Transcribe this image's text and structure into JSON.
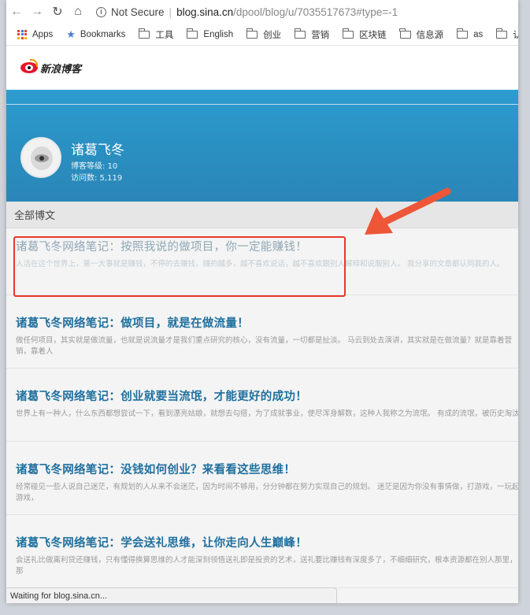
{
  "browser": {
    "not_secure": "Not Secure",
    "url_host": "blog.sina.cn",
    "url_path": "/dpool/blog/u/7035517673#type=-1"
  },
  "bookmarks": [
    {
      "label": "Apps",
      "icon": "apps-icon"
    },
    {
      "label": "Bookmarks",
      "icon": "star-icon"
    },
    {
      "label": "工具",
      "icon": "folder-icon"
    },
    {
      "label": "English",
      "icon": "folder-icon"
    },
    {
      "label": "创业",
      "icon": "folder-icon"
    },
    {
      "label": "营销",
      "icon": "folder-icon"
    },
    {
      "label": "区块链",
      "icon": "folder-icon"
    },
    {
      "label": "信息源",
      "icon": "folder-icon"
    },
    {
      "label": "as",
      "icon": "folder-icon"
    },
    {
      "label": "认",
      "icon": "folder-icon"
    }
  ],
  "site": {
    "logo_text": "新浪博客"
  },
  "profile": {
    "name": "诸葛飞冬",
    "level": "博客等级: 10",
    "visits": "访问数: 5,119"
  },
  "section": {
    "title": "全部博文"
  },
  "posts": [
    {
      "title": "诸葛飞冬网络笔记：按照我说的做项目，你一定能赚钱！",
      "excerpt": "人活在这个世界上，第一大事就是赚钱，不停的去赚钱，赚的越多，越不喜欢说话，越不喜欢跟别人解释和说服别人。 我分享的文章都认同我的人。"
    },
    {
      "title": "诸葛飞冬网络笔记：做项目，就是在做流量！",
      "excerpt": "做任何项目，其实就是做流量，也就是说流量才是我们重点研究的核心，没有流量，一切都是扯淡。 马云到处去演讲，其实就是在做流量？就是靠着营销，靠着人"
    },
    {
      "title": "诸葛飞冬网络笔记：创业就要当流氓，才能更好的成功！",
      "excerpt": "世界上有一种人，什么东西都想尝试一下，看到漂亮姑娘，就想去勾搭，为了成就事业，使尽浑身解数，这种人我称之为流氓。 有成的流氓，被历史淘汰"
    },
    {
      "title": "诸葛飞冬网络笔记：没钱如何创业？来看看这些思维！",
      "excerpt": "经常碰见一些人说自己迷茫，有规划的人从来不会迷茫，因为时间不够用，分分钟都在努力实现自己的规划。 迷茫是因为你没有事情做，打游戏，一玩起游戏，"
    },
    {
      "title": "诸葛飞冬网络笔记：学会送礼思维，让你走向人生巅峰！",
      "excerpt": "会送礼比做离利贷还赚钱，只有懂得换算思维的人才能深刻领悟送礼即是投资的艺术，送礼要比赚钱有深度多了，不细细研究，根本资源都在别人那里，那"
    }
  ],
  "status_bar": "Waiting for blog.sina.cn...",
  "colors": {
    "banner": "#2a8fc1",
    "title_link": "#1f6f9e",
    "annotation_red": "#e8382a",
    "annotation_arrow": "#ee5638"
  }
}
